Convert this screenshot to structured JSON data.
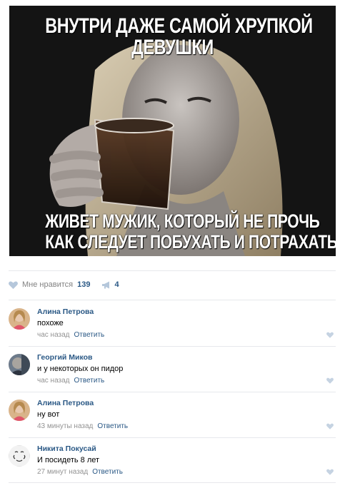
{
  "meme": {
    "caption_top_lines": [
      "ВНУТРИ ДАЖЕ САМОЙ ХРУПКОЙ",
      "ДЕВУШКИ"
    ],
    "caption_bottom_lines": [
      "ЖИВЕТ МУЖИК, КОТОРЫЙ НЕ ПРОЧЬ",
      "КАК СЛЕДУЕТ ПОБУХАТЬ И ПОТРАХАТЬСЯ"
    ]
  },
  "actions": {
    "like_label": "Мне нравится",
    "like_count": "139",
    "share_count": "4"
  },
  "colors": {
    "link": "#2a5885",
    "muted": "#939393",
    "divider": "#e7e8ec",
    "icon": "#b5c7db"
  },
  "comments": [
    {
      "author": "Алина Петрова",
      "text": "похоже",
      "time": "час назад",
      "reply": "Ответить",
      "avatar_icon": "avatar-photo-woman"
    },
    {
      "author": "Георгий Миков",
      "text": "и у некоторых он пидор",
      "time": "час назад",
      "reply": "Ответить",
      "avatar_icon": "avatar-photo-man"
    },
    {
      "author": "Алина Петрова",
      "text": "ну вот",
      "time": "43 минуты назад",
      "reply": "Ответить",
      "avatar_icon": "avatar-photo-woman"
    },
    {
      "author": "Никита Покусай",
      "text": "И посидеть 8 лет",
      "time": "27 минут назад",
      "reply": "Ответить",
      "avatar_icon": "avatar-drawing"
    }
  ]
}
